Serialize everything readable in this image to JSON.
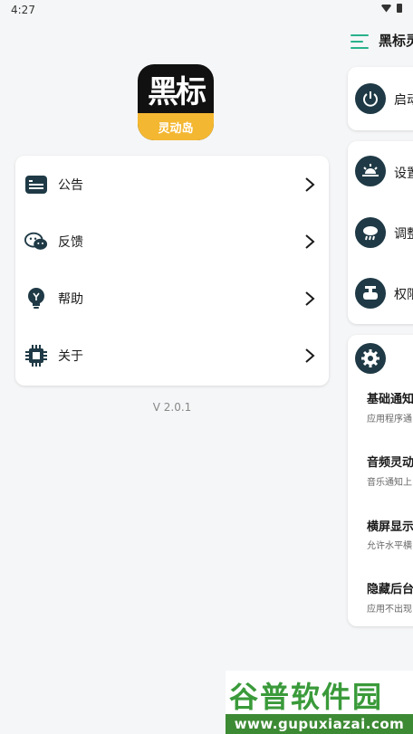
{
  "status_bar": {
    "time": "4:27"
  },
  "logo": {
    "top_text": "黑标",
    "bottom_text": "灵动岛"
  },
  "drawer": {
    "items": [
      {
        "label": "公告",
        "icon": "announcement-icon"
      },
      {
        "label": "反馈",
        "icon": "wechat-icon"
      },
      {
        "label": "帮助",
        "icon": "lightbulb-icon"
      },
      {
        "label": "关于",
        "icon": "chip-icon"
      }
    ],
    "version": "V 2.0.1"
  },
  "main": {
    "app_title": "黑标灵",
    "start_label": "启动",
    "settings_items": [
      {
        "label": "设置",
        "icon": "sunrise-icon"
      },
      {
        "label": "调整",
        "icon": "cloud-rain-icon"
      },
      {
        "label": "权限",
        "icon": "valve-icon"
      }
    ],
    "feature_settings": [
      {
        "title": "基础通知",
        "desc": "应用程序通"
      },
      {
        "title": "音频灵动",
        "desc": "音乐通知上"
      },
      {
        "title": "横屏显示",
        "desc": "允许水平横"
      },
      {
        "title": "隐藏后台",
        "desc": "应用不出现"
      }
    ]
  },
  "watermark": {
    "title": "谷普软件园",
    "url": "www.gupuxiazai.com"
  },
  "colors": {
    "accent": "#28b28c",
    "icon_dark": "#1f3a46",
    "logo_yellow": "#f4b731"
  }
}
